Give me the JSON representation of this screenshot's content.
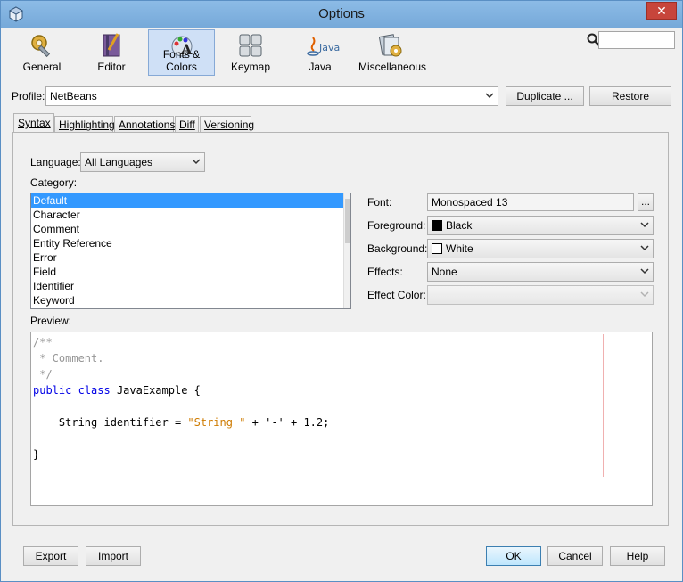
{
  "window": {
    "title": "Options",
    "close_label": "✕"
  },
  "toolbar": {
    "categories": [
      {
        "label": "General",
        "icon": "gear-wrench-icon"
      },
      {
        "label": "Editor",
        "icon": "notebook-icon"
      },
      {
        "label": "Fonts & Colors",
        "icon": "font-palette-icon",
        "selected": true
      },
      {
        "label": "Keymap",
        "icon": "keyboard-icon"
      },
      {
        "label": "Java",
        "icon": "java-logo-icon"
      },
      {
        "label": "Miscellaneous",
        "icon": "cards-gear-icon"
      }
    ],
    "search_value": ""
  },
  "profile": {
    "label": "Profile:",
    "value": "NetBeans",
    "duplicate_label": "Duplicate ...",
    "restore_label": "Restore"
  },
  "tabs": [
    "Syntax",
    "Highlighting",
    "Annotations",
    "Diff",
    "Versioning"
  ],
  "syntax": {
    "language_label": "Language:",
    "language_value": "All Languages",
    "category_label": "Category:",
    "categories": [
      "Default",
      "Character",
      "Comment",
      "Entity Reference",
      "Error",
      "Field",
      "Identifier",
      "Keyword"
    ],
    "selected_category": "Default",
    "font_label": "Font:",
    "font_value": "Monospaced 13",
    "font_button": "...",
    "foreground_label": "Foreground:",
    "foreground_value": "Black",
    "foreground_color": "#000000",
    "background_label": "Background:",
    "background_value": "White",
    "background_color": "#ffffff",
    "effects_label": "Effects:",
    "effects_value": "None",
    "effect_color_label": "Effect Color:",
    "effect_color_value": "",
    "preview_label": "Preview:"
  },
  "preview": {
    "line1": "/**",
    "line2": " * Comment.",
    "line3": " */",
    "kw_public": "public",
    "kw_class": "class",
    "class_rest": " JavaExample {",
    "stmt_start": "    String identifier = ",
    "string_literal": "\"String \"",
    "stmt_end": " + '-' + 1.2;",
    "close_brace": "}"
  },
  "footer": {
    "export_label": "Export",
    "import_label": "Import",
    "ok_label": "OK",
    "cancel_label": "Cancel",
    "help_label": "Help"
  },
  "colors": {
    "selection": "#3399ff",
    "keyword": "#0000e6",
    "string": "#ce7b00",
    "comment": "#969696"
  }
}
